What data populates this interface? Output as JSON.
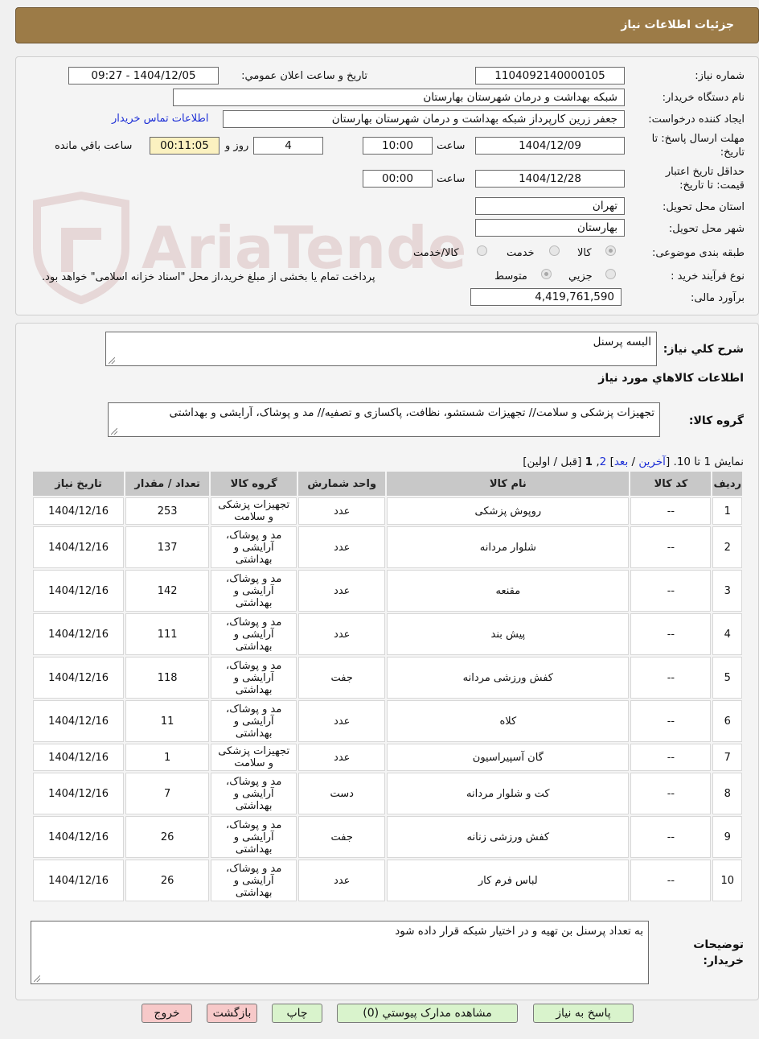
{
  "page_title": "جزئیات اطلاعات نیاز",
  "watermark_text": "AriaTender.neT",
  "fields": {
    "need_number_label": "شماره نیاز:",
    "need_number": "1104092140000105",
    "announce_label": "تاريخ و ساعت اعلان عمومي:",
    "announce_value": "1404/12/05 - 09:27",
    "buyer_org_label": "نام دستگاه خريدار:",
    "buyer_org": "شبکه بهداشت و درمان شهرستان بهارستان",
    "creator_label": "ايجاد کننده درخواست:",
    "creator": "جعفر زرین کارپرداز شبکه بهداشت و درمان شهرستان بهارستان",
    "contact_link": "اطلاعات تماس خريدار",
    "deadline_label_line1": "مهلت ارسال پاسخ: تا",
    "deadline_label_line2": "تاريخ:",
    "deadline_date": "1404/12/09",
    "time_word": "ساعت",
    "deadline_time": "10:00",
    "days": "4",
    "day_word": "روز و",
    "remaining_time": "00:11:05",
    "remaining_word": "ساعت باقي مانده",
    "validity_label_line1": "حداقل تاريخ اعتبار",
    "validity_label_line2": "قيمت: تا تاريخ:",
    "validity_date": "1404/12/28",
    "validity_time": "00:00",
    "province_label": "استان محل تحويل:",
    "province": "تهران",
    "city_label": "شهر محل تحويل:",
    "city": "بهارستان",
    "category_label": "طبقه بندی موضوعی:",
    "category_options": [
      "کالا",
      "خدمت",
      "کالا/خدمت"
    ],
    "process_label": "نوع فرآيند خريد :",
    "process_options": [
      "جزيي",
      "متوسط"
    ],
    "payment_note": "پرداخت تمام یا بخشی از مبلغ خرید،از محل \"اسناد خزانه اسلامی\" خواهد بود.",
    "estimate_label": "برآورد مالی:",
    "estimate": "4,419,761,590"
  },
  "details": {
    "summary_label": "شرح کلي نياز:",
    "summary": "البسه پرسنل",
    "goods_info_title": "اطلاعات کالاهاي مورد نياز",
    "goods_group_label": "گروه کالا:",
    "goods_group": "تجهیزات پزشکی و سلامت// تجهیزات شستشو، نظافت، پاکسازی و تصفیه// مد و پوشاک، آرایشی و بهداشتی",
    "pagination": {
      "showing": "نمايش 1 تا 10.",
      "open": "[",
      "last": "آخرين",
      "sep1": "/",
      "next": "بعد",
      "close1": "]",
      "page2": "2",
      "comma": ",",
      "page1": "1",
      "prev_first": "[قبل / اولين]"
    }
  },
  "table": {
    "headers": [
      "رديف",
      "کد کالا",
      "نام کالا",
      "واحد شمارش",
      "گروه کالا",
      "تعداد / مقدار",
      "تاريخ نياز"
    ],
    "rows": [
      [
        "1",
        "--",
        "روپوش پزشکی",
        "عدد",
        "تجهیزات پزشکی و سلامت",
        "253",
        "1404/12/16"
      ],
      [
        "2",
        "--",
        "شلوار مردانه",
        "عدد",
        "مد و پوشاک، آرایشی و بهداشتی",
        "137",
        "1404/12/16"
      ],
      [
        "3",
        "--",
        "مقنعه",
        "عدد",
        "مد و پوشاک، آرایشی و بهداشتی",
        "142",
        "1404/12/16"
      ],
      [
        "4",
        "--",
        "پیش بند",
        "عدد",
        "مد و پوشاک، آرایشی و بهداشتی",
        "111",
        "1404/12/16"
      ],
      [
        "5",
        "--",
        "کفش ورزشی مردانه",
        "جفت",
        "مد و پوشاک، آرایشی و بهداشتی",
        "118",
        "1404/12/16"
      ],
      [
        "6",
        "--",
        "کلاه",
        "عدد",
        "مد و پوشاک، آرایشی و بهداشتی",
        "11",
        "1404/12/16"
      ],
      [
        "7",
        "--",
        "گان آسپیراسیون",
        "عدد",
        "تجهیزات پزشکی و سلامت",
        "1",
        "1404/12/16"
      ],
      [
        "8",
        "--",
        "کت و شلوار مردانه",
        "دست",
        "مد و پوشاک، آرایشی و بهداشتی",
        "7",
        "1404/12/16"
      ],
      [
        "9",
        "--",
        "کفش ورزشی زنانه",
        "جفت",
        "مد و پوشاک، آرایشی و بهداشتی",
        "26",
        "1404/12/16"
      ],
      [
        "10",
        "--",
        "لباس فرم کار",
        "عدد",
        "مد و پوشاک، آرایشی و بهداشتی",
        "26",
        "1404/12/16"
      ]
    ]
  },
  "buyer_notes": {
    "label_line1": "توضیحات",
    "label_line2": "خریدار:",
    "text": "به تعداد پرسنل بن تهیه و در اختیار شبکه قرار داده شود"
  },
  "buttons": {
    "reply": "پاسخ به نياز",
    "attachments": "مشاهده مدارک پيوستي (0)",
    "print": "چاپ",
    "back": "بازگشت",
    "exit": "خروج"
  },
  "colors": {
    "title_bar": "#9c7b47",
    "link": "#1d2fd6",
    "button_green": "#d9f3cc",
    "button_pink": "#f7c9c9",
    "remaining_bg": "#fbf1c0"
  }
}
